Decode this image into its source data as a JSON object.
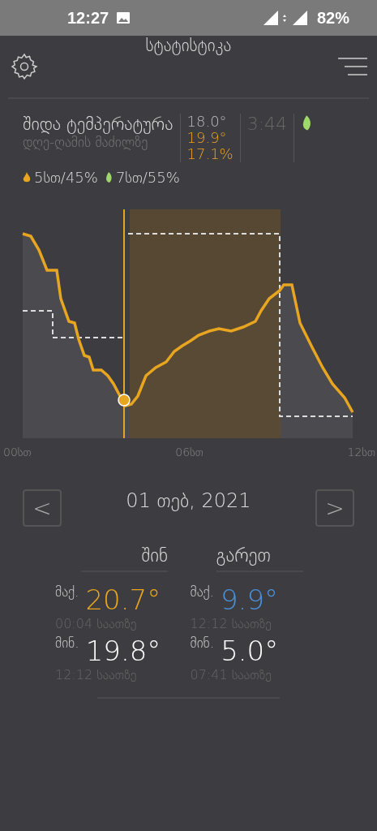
{
  "status_bar": {
    "time": "12:27",
    "battery": "82%"
  },
  "header": {
    "title": "სტატისტიკა"
  },
  "summary": {
    "title": "შიდა ტემპერატურა",
    "subtitle": "დღე-ღამის მაძილზე",
    "temp_set": "18.0°",
    "temp_current": "19.9°",
    "percent": "17.1%",
    "time": "3:44",
    "modes": [
      {
        "kind": "heat",
        "label": "5სთ/45%"
      },
      {
        "kind": "eco",
        "label": "7სთ/55%"
      }
    ]
  },
  "chart": {
    "x_labels": [
      "00სთ",
      "06სთ",
      "12სთ"
    ]
  },
  "date_nav": {
    "prev": "<",
    "date": "01 თებ, 2021",
    "next": ">"
  },
  "stats": [
    {
      "heading": "შინ",
      "rows": [
        {
          "label": "მაქ.",
          "value": "20.7°",
          "color": "#e8a520",
          "time": "00:04 საათზე"
        },
        {
          "label": "მინ.",
          "value": "19.8°",
          "color": "#ffffff",
          "time": "12:12 საათზე"
        }
      ]
    },
    {
      "heading": "გარეთ",
      "rows": [
        {
          "label": "მაქ.",
          "value": "9.9°",
          "color": "#4a90d9",
          "time": "12:12 საათზე"
        },
        {
          "label": "მინ.",
          "value": "5.0°",
          "color": "#ffffff",
          "time": "07:41 საათზე"
        }
      ]
    }
  ]
}
